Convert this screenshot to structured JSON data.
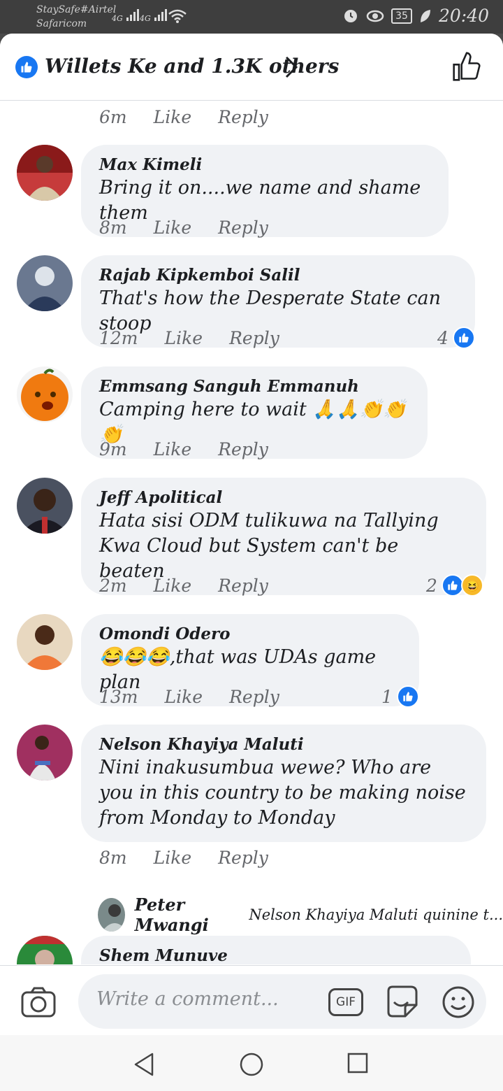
{
  "status_bar": {
    "carrier_1": "StaySafe#Airtel",
    "carrier_2": "Safaricom",
    "network_1": "4G",
    "network_2": "4G",
    "battery": "35",
    "time": "20:40"
  },
  "header": {
    "reactions_title": "Willets Ke and 1.3K others"
  },
  "top_meta": {
    "time": "6m",
    "like": "Like",
    "reply": "Reply"
  },
  "comments": [
    {
      "name": "Max Kimeli",
      "text": "Bring it on....we name and shame them",
      "time": "8m",
      "like": "Like",
      "reply": "Reply"
    },
    {
      "name": "Rajab Kipkemboi Salil",
      "text": "That's how the Desperate State can stoop",
      "time": "12m",
      "like": "Like",
      "reply": "Reply",
      "reaction_count": "4"
    },
    {
      "name": "Emmsang Sanguh Emmanuh",
      "text": "Camping here to wait 🙏🙏👏👏👏",
      "time": "9m",
      "like": "Like",
      "reply": "Reply"
    },
    {
      "name": "Jeff Apolitical",
      "text": "Hata sisi ODM tulikuwa na Tallying Kwa Cloud but System can't be beaten",
      "time": "2m",
      "like": "Like",
      "reply": "Reply",
      "reaction_count": "2"
    },
    {
      "name": "Omondi Odero",
      "text": "😂😂😂,that was UDAs game plan",
      "time": "13m",
      "like": "Like",
      "reply": "Reply",
      "reaction_count": "1"
    },
    {
      "name": "Nelson Khayiya Maluti",
      "text": "Nini inakusumbua wewe? Who are you in this country to be making noise from Monday to Monday",
      "time": "8m",
      "like": "Like",
      "reply": "Reply"
    },
    {
      "name": "Shem Munuve",
      "text": ""
    }
  ],
  "reply_preview": {
    "name": "Peter Mwangi",
    "text": "Nelson Khayiya Maluti quinine t..."
  },
  "composer": {
    "placeholder": "Write a comment...",
    "gif_label": "GIF"
  },
  "colors": {
    "accent": "#1877f2",
    "bubble": "#f0f2f5",
    "meta_text": "#65676b"
  }
}
